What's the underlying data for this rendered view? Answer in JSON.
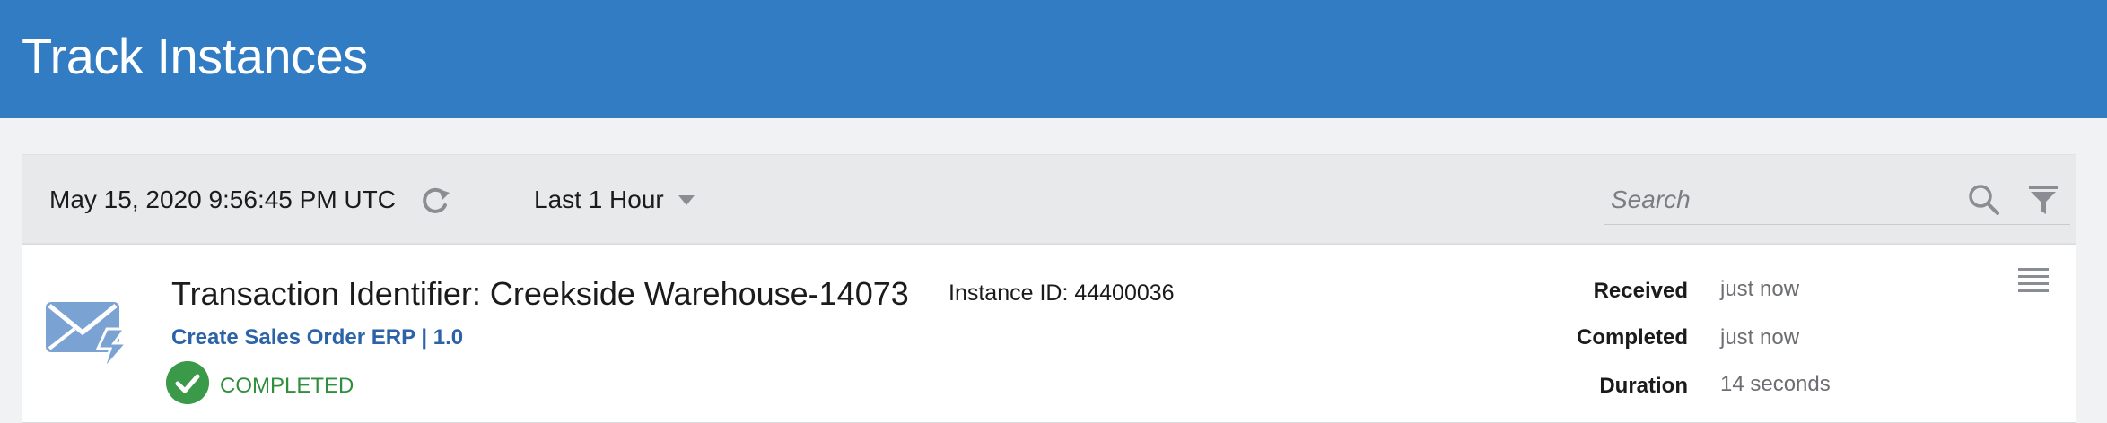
{
  "header": {
    "title": "Track Instances"
  },
  "toolbar": {
    "timestamp": "May 15, 2020 9:56:45 PM UTC",
    "range_label": "Last 1 Hour",
    "search_placeholder": "Search"
  },
  "instance": {
    "title": "Transaction Identifier: Creekside Warehouse-14073",
    "instance_id": "Instance ID: 44400036",
    "integration": "Create Sales Order ERP | 1.0",
    "status": "COMPLETED",
    "received_label": "Received",
    "received_value": "just now",
    "completed_label": "Completed",
    "completed_value": "just now",
    "duration_label": "Duration",
    "duration_value": "14 seconds"
  },
  "colors": {
    "header_bg": "#317cc3",
    "status_green": "#3a9a49",
    "link_blue": "#2c63a8"
  },
  "icons": [
    "refresh-icon",
    "chevron-down-icon",
    "search-icon",
    "filter-icon",
    "envelope-icon",
    "check-icon",
    "menu-icon"
  ]
}
